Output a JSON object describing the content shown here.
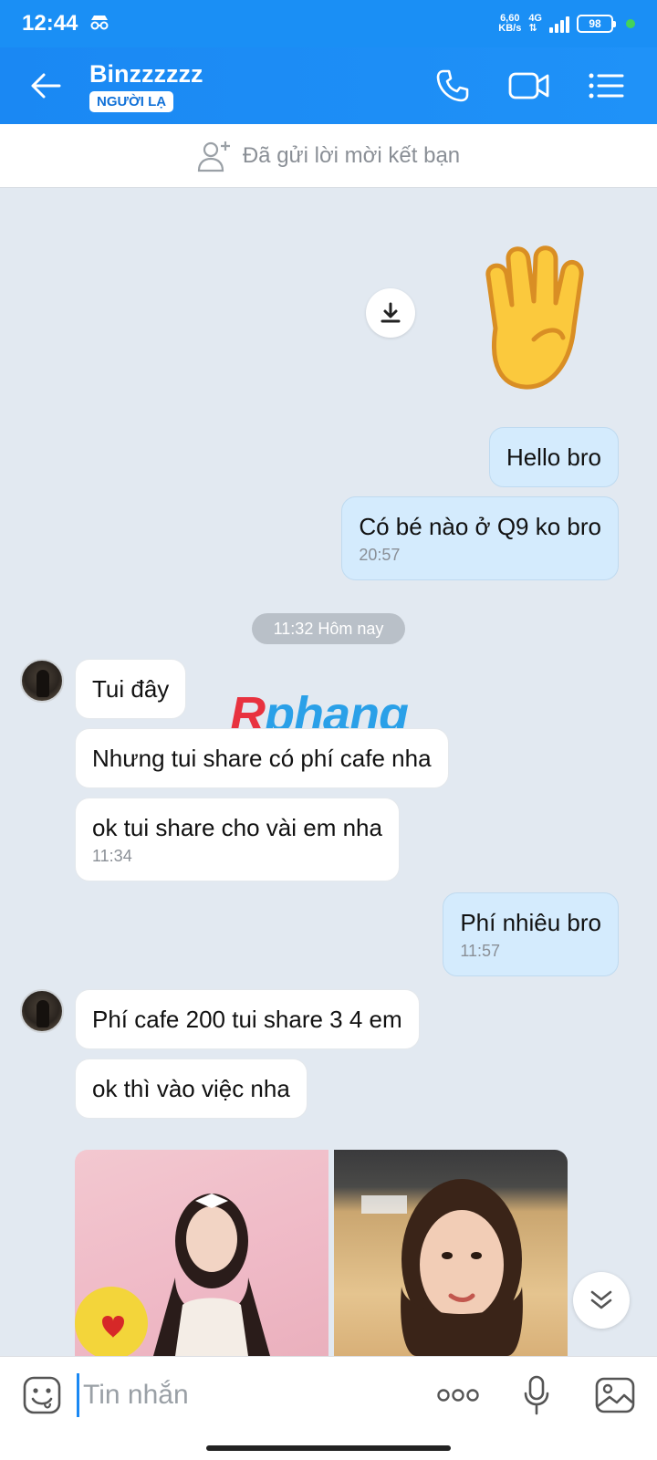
{
  "status_bar": {
    "time": "12:44",
    "net_speed_value": "6,60",
    "net_speed_unit": "KB/s",
    "network_type": "4G",
    "battery": "98"
  },
  "header": {
    "contact_name": "Binzzzzzz",
    "badge": "NGƯỜI LẠ",
    "accent_color": "#1a88f3"
  },
  "friend_request": {
    "text": "Đã gửi lời mời kết bạn"
  },
  "messages": [
    {
      "side": "out",
      "text": "Hello bro"
    },
    {
      "side": "out",
      "text": "Có bé nào ở Q9 ko bro",
      "time": "20:57"
    },
    {
      "side": "divider",
      "text": "11:32 Hôm nay"
    },
    {
      "side": "in",
      "text": "Tui đây"
    },
    {
      "side": "in",
      "text": "Nhưng tui share có phí cafe nha"
    },
    {
      "side": "in",
      "text": "ok tui share cho vài em nha",
      "time": "11:34"
    },
    {
      "side": "out",
      "text": "Phí nhiêu bro",
      "time": "11:57"
    },
    {
      "side": "in",
      "text": "Phí cafe 200 tui share 3 4 em"
    },
    {
      "side": "in",
      "text": "ok thì vào việc nha"
    }
  ],
  "watermark": {
    "part1": "R",
    "part2": "phang"
  },
  "input": {
    "placeholder": "Tin nhắn"
  },
  "icons": {
    "back": "arrow-left-icon",
    "call": "phone-icon",
    "video": "video-camera-icon",
    "menu": "list-menu-icon",
    "add_friend": "add-user-icon",
    "download": "download-icon",
    "scroll_down": "double-chevron-down-icon",
    "emoji": "emoji-icon",
    "more": "more-dots-icon",
    "mic": "microphone-icon",
    "gallery": "image-icon"
  }
}
